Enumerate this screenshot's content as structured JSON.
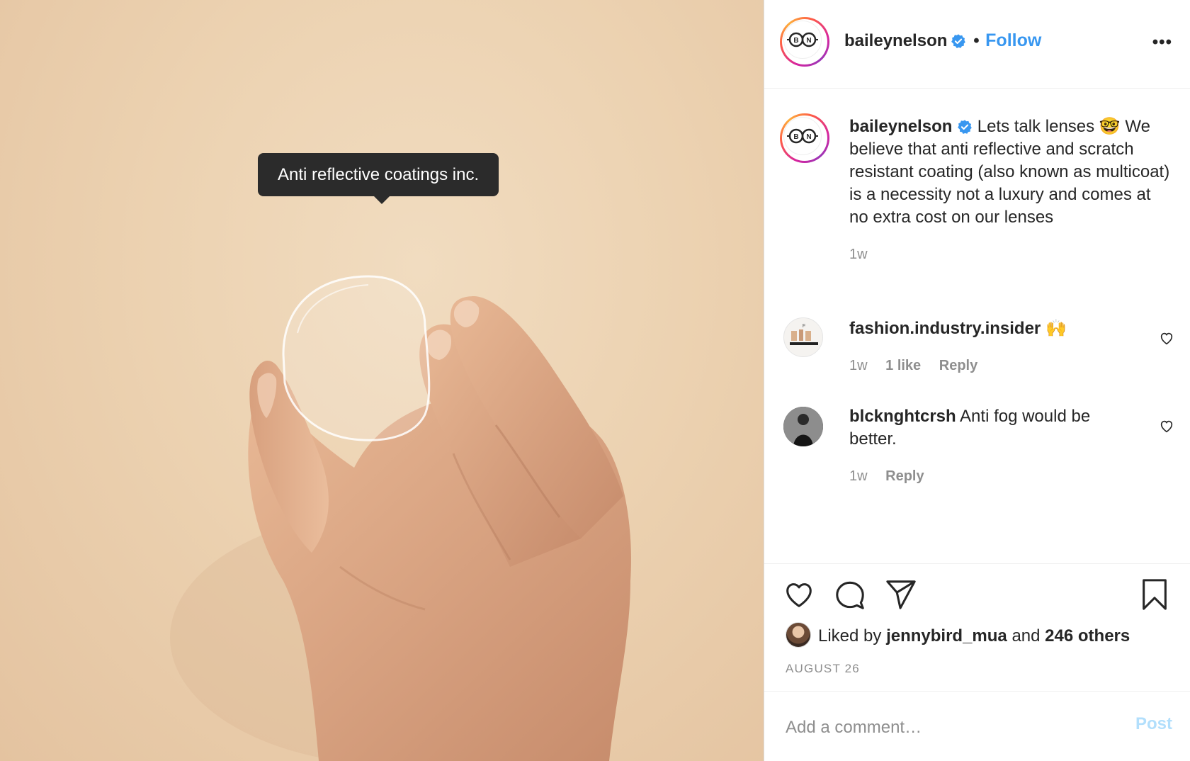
{
  "photo": {
    "tag_text": "Anti reflective coatings inc."
  },
  "header": {
    "username": "baileynelson",
    "separator": "•",
    "follow_label": "Follow",
    "more_label": "•••",
    "avatar_letters": [
      "B",
      "N"
    ]
  },
  "caption": {
    "username": "baileynelson",
    "text_before_emoji": "Lets talk lenses",
    "emoji": "🤓",
    "text_after_emoji": "We believe that anti reflective and scratch resistant coating (also known as multicoat) is a necessity not a luxury and comes at no extra cost on our lenses",
    "time": "1w"
  },
  "comments": [
    {
      "username": "fashion.industry.insider",
      "text": "🙌",
      "time": "1w",
      "likes": "1 like",
      "reply": "Reply"
    },
    {
      "username": "blcknghtcrsh",
      "text": "Anti fog would be better.",
      "time": "1w",
      "reply": "Reply"
    }
  ],
  "actions": {
    "liked_prefix": "Liked by",
    "liked_user": "jennybird_mua",
    "liked_and": "and",
    "liked_others": "246 others",
    "date": "AUGUST 26"
  },
  "add_comment": {
    "placeholder": "Add a comment…",
    "post_label": "Post"
  },
  "colors": {
    "accent": "#3897f0",
    "verified": "#3897f0",
    "muted": "#8e8e8e",
    "post_disabled": "#b2dffc"
  }
}
